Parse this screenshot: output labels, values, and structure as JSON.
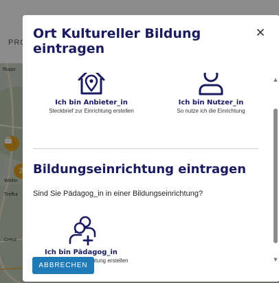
{
  "background": {
    "header_text": "PRO",
    "map_labels": [
      "Ruppr",
      "Weiler",
      "Treffur",
      "Creuz"
    ],
    "marker_number": "2"
  },
  "modal": {
    "title": "Ort Kultureller Bildung eintragen",
    "choices": {
      "provider": {
        "icon": "home-location-icon",
        "title": "Ich bin Anbieter_in",
        "description": "Steckbrief zur Einrichtung erstellen"
      },
      "user": {
        "icon": "user-icon",
        "title": "Ich bin Nutzer_in",
        "description": "So nutze ich die Einrichtung"
      },
      "educator": {
        "icon": "add-user-icon",
        "title": "Ich bin Pädagog_in",
        "description": "Steckbrief meiner Einrichtung erstellen"
      }
    },
    "section_title": "Bildungseinrichtung eintragen",
    "section_question": "Sind Sie Pädagog_in in einer Bildungseinrichtung?",
    "cancel_label": "ABBRECHEN",
    "colors": {
      "heading": "#1a1b5e",
      "button": "#1f7ab8",
      "marker": "#e6a21d"
    }
  }
}
